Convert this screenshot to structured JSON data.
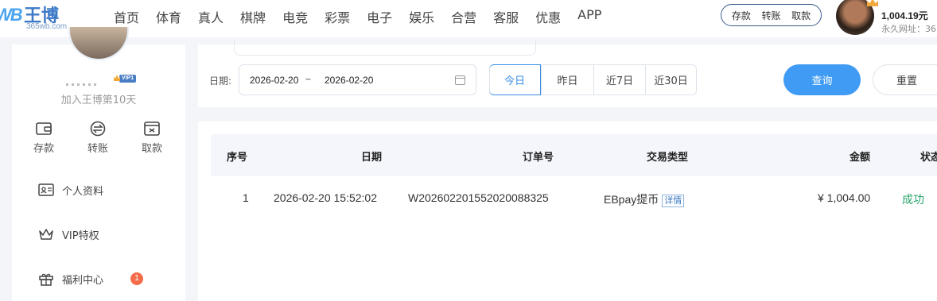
{
  "brand": {
    "mark": "WB",
    "name": "王博",
    "domain": "365wb.com"
  },
  "nav": [
    "首页",
    "体育",
    "真人",
    "棋牌",
    "电竞",
    "彩票",
    "电子",
    "娱乐",
    "合营",
    "客服",
    "优惠",
    "APP"
  ],
  "quick_actions": [
    "存款",
    "转账",
    "取款"
  ],
  "account": {
    "balance": "1,004.19元",
    "url_label": "永久网址：36"
  },
  "sidebar": {
    "vip_badge": "VIP1",
    "join_text": "加入王博第10天",
    "actions": [
      {
        "label": "存款",
        "icon": "wallet-icon"
      },
      {
        "label": "转账",
        "icon": "transfer-icon"
      },
      {
        "label": "取款",
        "icon": "withdraw-icon"
      }
    ],
    "menu": [
      {
        "label": "个人资料",
        "icon": "id-card-icon"
      },
      {
        "label": "VIP特权",
        "icon": "crown-icon"
      },
      {
        "label": "福利中心",
        "icon": "gift-icon",
        "badge": "1"
      }
    ]
  },
  "filter": {
    "date_label": "日期:",
    "start_date": "2026-02-20",
    "separator": "~",
    "end_date": "2026-02-20",
    "ranges": [
      "今日",
      "昨日",
      "近7日",
      "近30日"
    ],
    "active_range": "今日",
    "query_label": "查询",
    "reset_label": "重置"
  },
  "table": {
    "headers": [
      "序号",
      "日期",
      "订单号",
      "交易类型",
      "金额",
      "状态"
    ],
    "rows": [
      {
        "index": "1",
        "date": "2026-02-20 15:52:02",
        "order_no": "W202602201552020088325",
        "type": "EBpay提币",
        "detail": "详情",
        "amount": "¥ 1,004.00",
        "status": "成功"
      }
    ]
  },
  "colors": {
    "primary": "#3f9bf3",
    "success": "#2aa66a",
    "badge": "#f56c4a"
  }
}
